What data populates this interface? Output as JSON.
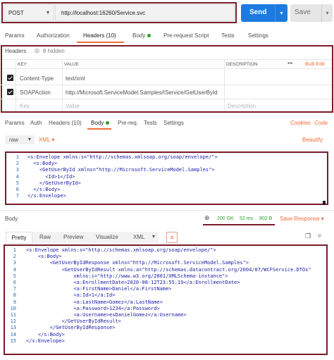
{
  "request": {
    "method": "POST",
    "url": "http://localhost:16260/Service.svc",
    "send_label": "Send",
    "save_label": "Save"
  },
  "request_tabs": [
    {
      "label": "Params"
    },
    {
      "label": "Authorization"
    },
    {
      "label": "Headers (10)"
    },
    {
      "label": "Body"
    },
    {
      "label": "Pre-request Script"
    },
    {
      "label": "Tests"
    },
    {
      "label": "Settings"
    }
  ],
  "headers_section": {
    "title": "Headers",
    "hidden_label": "8 hidden",
    "col_key": "KEY",
    "col_value": "VALUE",
    "col_description": "DESCRIPTION",
    "more": "•••",
    "bulk_edit": "Bulk Edit",
    "rows": [
      {
        "key": "Content-Type",
        "value": "text/xml"
      },
      {
        "key": "SOAPAction",
        "value": "http://Microsoft.ServiceModel.Samples/IService/GetUserById"
      }
    ],
    "placeholder_key": "Key",
    "placeholder_value": "Value",
    "placeholder_description": "Description"
  },
  "second_tabs": [
    {
      "label": "Params"
    },
    {
      "label": "Auth"
    },
    {
      "label": "Headers (10)"
    },
    {
      "label": "Body"
    },
    {
      "label": "Pre-req."
    },
    {
      "label": "Tests"
    },
    {
      "label": "Settings"
    }
  ],
  "cookies_label": "Cookies",
  "code_label": "Code",
  "body_mode": {
    "raw": "raw",
    "format": "XML",
    "beautify": "Beautify"
  },
  "request_body_lines": [
    "<s:Envelope xmlns:s=\"http://schemas.xmlsoap.org/soap/envelope/\">",
    "  <s:Body>",
    "    <GetUserById xmlns=\"http://Microsoft.ServiceModel.Samples\">",
    "      <Id>1</Id>",
    "    </GetUserById>",
    "  </s:Body>",
    "</s:Envelope>"
  ],
  "response": {
    "body_label": "Body",
    "status": "200 OK",
    "time": "52 ms",
    "size": "802 B",
    "save_response": "Save Response",
    "view_tabs": [
      "Pretty",
      "Raw",
      "Preview",
      "Visualize"
    ],
    "format": "XML",
    "lines": [
      "<s:Envelope xmlns:s=\"http://schemas.xmlsoap.org/soap/envelope/\">",
      "    <s:Body>",
      "        <GetUserByIdResponse xmlns=\"http://Microsoft.ServiceModel.Samples\">",
      "            <GetUserByIdResult xmlns:a=\"http://schemas.datacontract.org/2004/07/WCFService.DTOs\"",
      "                xmlns:i=\"http://www.w3.org/2001/XMLSchema-instance\">",
      "                <a:EnrollmentDate>2020-08-12T23:55:19</a:EnrollmentDate>",
      "                <a:FirstName>Daniel</a:FirstName>",
      "                <a:Id>1</a:Id>",
      "                <a:LastName>Gomez</a:LastName>",
      "                <a:Password>1234</a:Password>",
      "                <a:Username>esDanielGomez</a:Username>",
      "            </GetUserByIdResult>",
      "        </GetUserByIdResponse>",
      "    </s:Body>",
      "</s:Envelope>"
    ]
  },
  "colors": {
    "accent": "#f26b3a",
    "send": "#1c7ae0",
    "frame": "#7a1b2a",
    "ok": "#2ca02c"
  }
}
